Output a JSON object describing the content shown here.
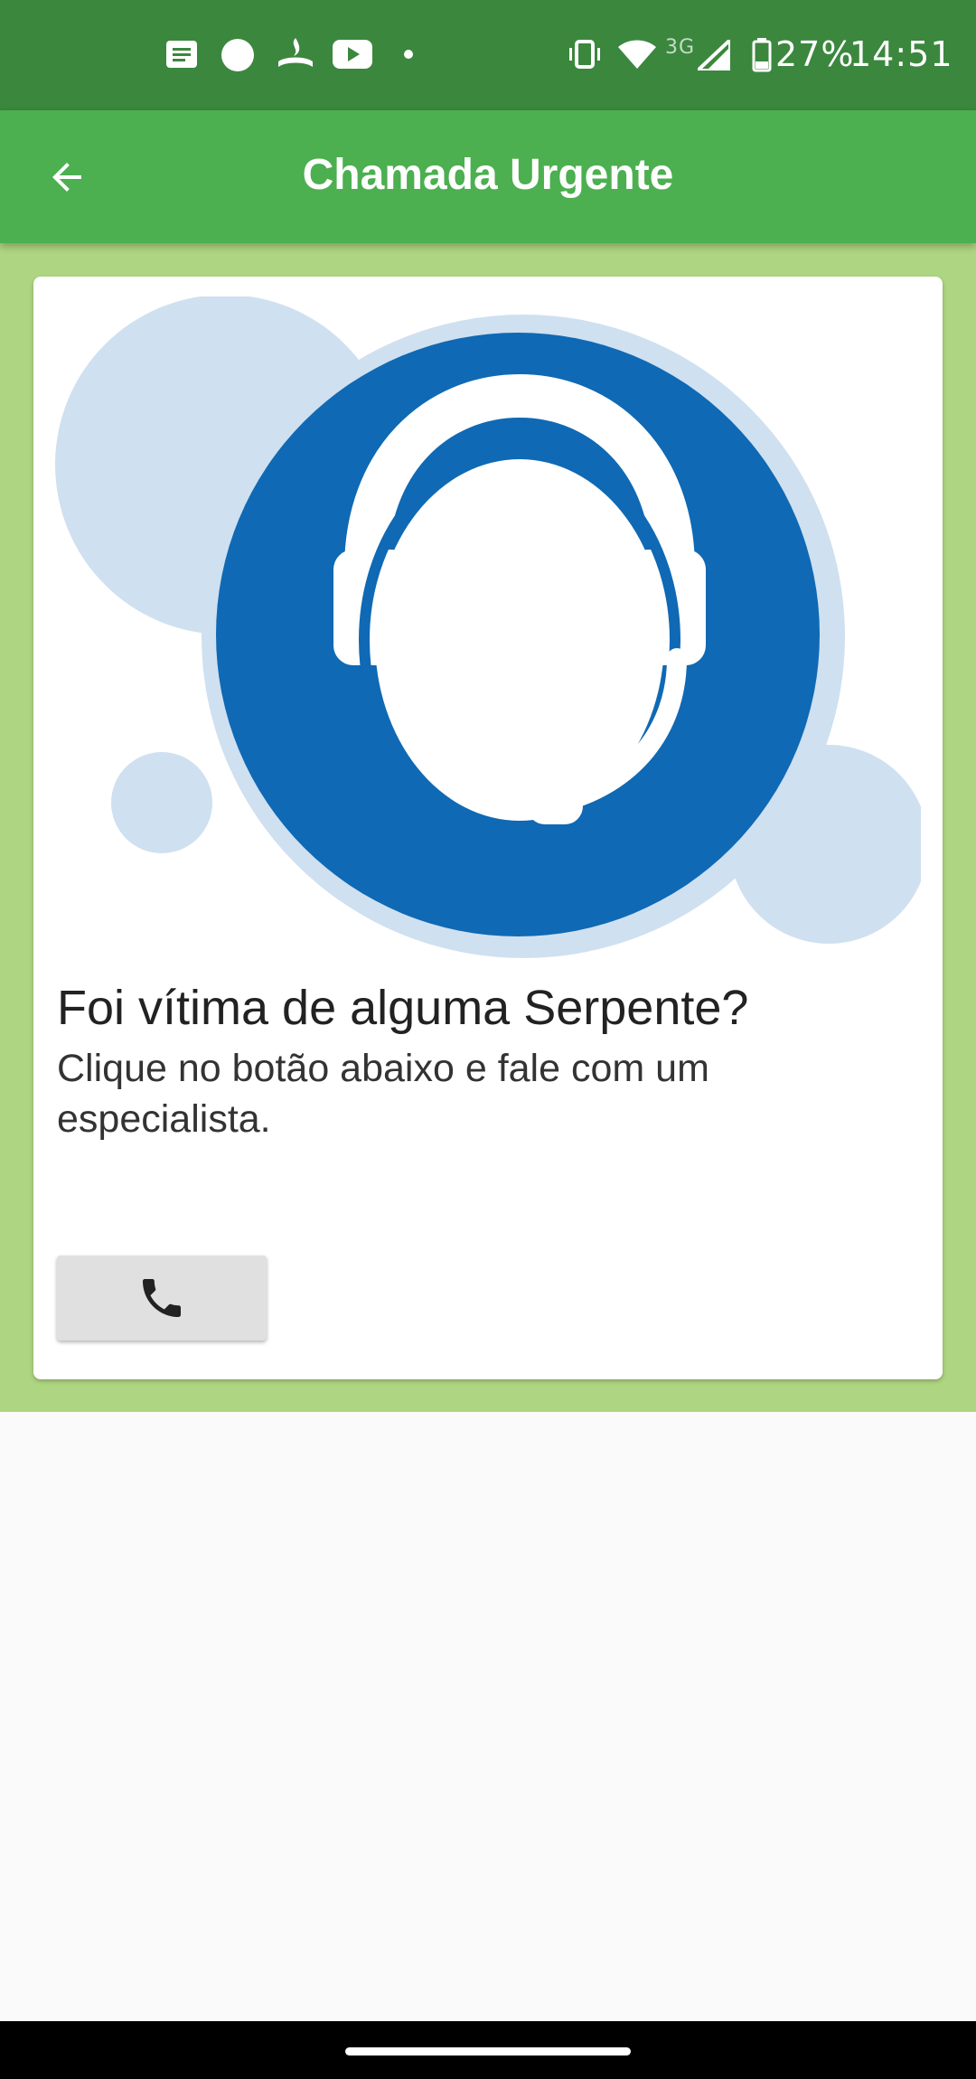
{
  "status_bar": {
    "battery": "27%",
    "time": "14:51",
    "network": "3G",
    "icons": [
      "notification-icon",
      "circle-icon",
      "santander-icon",
      "youtube-icon",
      "dot-icon",
      "vibrate-icon",
      "wifi-icon",
      "signal-icon",
      "battery-icon"
    ]
  },
  "app_bar": {
    "title": "Chamada Urgente",
    "back_icon": "arrow-back-icon"
  },
  "card": {
    "heading": "Foi vítima de alguma Serpente?",
    "body": "Clique no botão abaixo e fale com um especialista.",
    "call_icon": "phone-icon",
    "illustration": "support-headset-icon"
  },
  "colors": {
    "status_bar": "#3b873e",
    "app_bar": "#4caf50",
    "section_bg": "#aed581",
    "illustration_blue": "#0f69b4",
    "illustration_light": "#cfe0f0"
  }
}
